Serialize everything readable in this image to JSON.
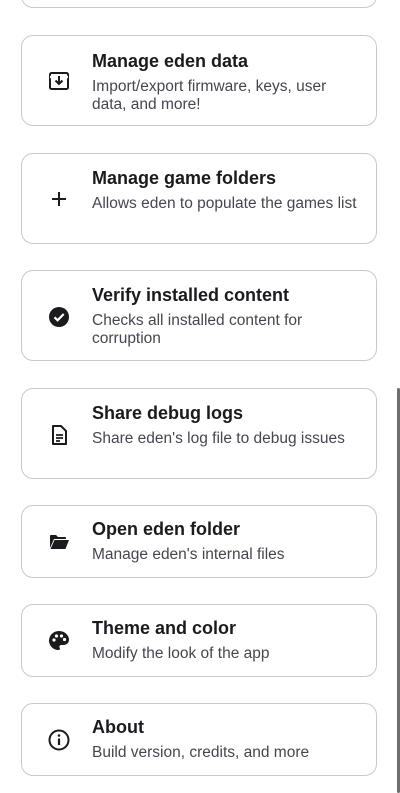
{
  "settings": {
    "items": [
      {
        "title": "Manage eden data",
        "description": "Import/export firmware, keys, user data, and more!",
        "icon": "download-box-icon"
      },
      {
        "title": "Manage game folders",
        "description": "Allows eden to populate the games list",
        "icon": "plus-icon"
      },
      {
        "title": "Verify installed content",
        "description": "Checks all installed content for corruption",
        "icon": "check-circle-icon"
      },
      {
        "title": "Share debug logs",
        "description": "Share eden's log file to debug issues",
        "icon": "document-icon"
      },
      {
        "title": "Open eden folder",
        "description": "Manage eden's internal files",
        "icon": "folder-open-icon"
      },
      {
        "title": "Theme and color",
        "description": "Modify the look of the app",
        "icon": "palette-icon"
      },
      {
        "title": "About",
        "description": "Build version, credits, and more",
        "icon": "info-icon"
      }
    ]
  },
  "colors": {
    "card_border": "#c9c9cc",
    "title_text": "#1b1b1f",
    "description_text": "#45464f"
  }
}
